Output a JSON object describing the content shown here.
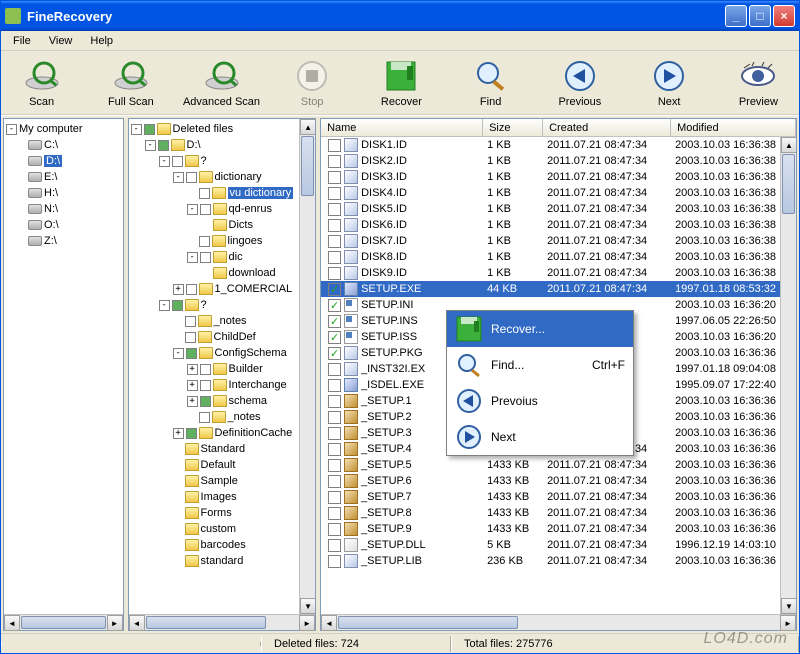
{
  "window": {
    "title": "FineRecovery"
  },
  "menu": {
    "file": "File",
    "view": "View",
    "help": "Help"
  },
  "toolbar": {
    "scan": "Scan",
    "fullscan": "Full Scan",
    "advscan": "Advanced Scan",
    "stop": "Stop",
    "recover": "Recover",
    "find": "Find",
    "previous": "Previous",
    "next": "Next",
    "preview": "Preview"
  },
  "drives": {
    "root": "My computer",
    "items": [
      "C:\\",
      "D:\\",
      "E:\\",
      "H:\\",
      "N:\\",
      "O:\\",
      "Z:\\"
    ]
  },
  "tree": {
    "root": "Deleted files",
    "d": "D:\\",
    "qa": "?",
    "dictionary": "dictionary",
    "vu": "vu dictionary",
    "qdenrus": "qd-enrus",
    "dicts": "Dicts",
    "lingoes": "lingoes",
    "dic": "dic",
    "download": "download",
    "comercial": "1_COMERCIAL",
    "qb": "?",
    "notes": "_notes",
    "childdef": "ChildDef",
    "configschema": "ConfigSchema",
    "builder": "Builder",
    "interchange": "Interchange",
    "schema": "schema",
    "notes2": "_notes",
    "defcache": "DefinitionCache",
    "standard": "Standard",
    "default": "Default",
    "sample": "Sample",
    "images": "Images",
    "forms": "Forms",
    "custom": "custom",
    "barcodes": "barcodes",
    "standard2": "standard"
  },
  "cols": {
    "name": "Name",
    "size": "Size",
    "created": "Created",
    "modified": "Modified"
  },
  "files": [
    {
      "ck": false,
      "name": "DISK1.ID",
      "ico": "id",
      "size": "1 KB",
      "created": "2011.07.21 08:47:34",
      "modified": "2003.10.03 16:36:38"
    },
    {
      "ck": false,
      "name": "DISK2.ID",
      "ico": "id",
      "size": "1 KB",
      "created": "2011.07.21 08:47:34",
      "modified": "2003.10.03 16:36:38"
    },
    {
      "ck": false,
      "name": "DISK3.ID",
      "ico": "id",
      "size": "1 KB",
      "created": "2011.07.21 08:47:34",
      "modified": "2003.10.03 16:36:38"
    },
    {
      "ck": false,
      "name": "DISK4.ID",
      "ico": "id",
      "size": "1 KB",
      "created": "2011.07.21 08:47:34",
      "modified": "2003.10.03 16:36:38"
    },
    {
      "ck": false,
      "name": "DISK5.ID",
      "ico": "id",
      "size": "1 KB",
      "created": "2011.07.21 08:47:34",
      "modified": "2003.10.03 16:36:38"
    },
    {
      "ck": false,
      "name": "DISK6.ID",
      "ico": "id",
      "size": "1 KB",
      "created": "2011.07.21 08:47:34",
      "modified": "2003.10.03 16:36:38"
    },
    {
      "ck": false,
      "name": "DISK7.ID",
      "ico": "id",
      "size": "1 KB",
      "created": "2011.07.21 08:47:34",
      "modified": "2003.10.03 16:36:38"
    },
    {
      "ck": false,
      "name": "DISK8.ID",
      "ico": "id",
      "size": "1 KB",
      "created": "2011.07.21 08:47:34",
      "modified": "2003.10.03 16:36:38"
    },
    {
      "ck": false,
      "name": "DISK9.ID",
      "ico": "id",
      "size": "1 KB",
      "created": "2011.07.21 08:47:34",
      "modified": "2003.10.03 16:36:38"
    },
    {
      "ck": true,
      "name": "SETUP.EXE",
      "ico": "exe",
      "size": "44 KB",
      "created": "2011.07.21 08:47:34",
      "modified": "1997.01.18 08:53:32",
      "sel": true
    },
    {
      "ck": true,
      "name": "SETUP.INI",
      "ico": "ini",
      "size": "",
      "created": "",
      "modified": "2003.10.03 16:36:20"
    },
    {
      "ck": true,
      "name": "SETUP.INS",
      "ico": "ini",
      "size": "",
      "created": "",
      "modified": "1997.06.05 22:26:50"
    },
    {
      "ck": true,
      "name": "SETUP.ISS",
      "ico": "ini",
      "size": "",
      "created": "",
      "modified": "2003.10.03 16:36:20"
    },
    {
      "ck": true,
      "name": "SETUP.PKG",
      "ico": "id",
      "size": "",
      "created": "",
      "modified": "2003.10.03 16:36:36"
    },
    {
      "ck": false,
      "name": "_INST32I.EX",
      "ico": "id",
      "size": "",
      "created": "",
      "modified": "1997.01.18 09:04:08"
    },
    {
      "ck": false,
      "name": "_ISDEL.EXE",
      "ico": "exe",
      "size": "",
      "created": "",
      "modified": "1995.09.07 17:22:40"
    },
    {
      "ck": false,
      "name": "_SETUP.1",
      "ico": "dat",
      "size": "",
      "created": "",
      "modified": "2003.10.03 16:36:36"
    },
    {
      "ck": false,
      "name": "_SETUP.2",
      "ico": "dat",
      "size": "",
      "created": "",
      "modified": "2003.10.03 16:36:36"
    },
    {
      "ck": false,
      "name": "_SETUP.3",
      "ico": "dat",
      "size": "",
      "created": "",
      "modified": "2003.10.03 16:36:36"
    },
    {
      "ck": false,
      "name": "_SETUP.4",
      "ico": "dat",
      "size": "",
      "created": "2011.07.21 08:47:34",
      "modified": "2003.10.03 16:36:36"
    },
    {
      "ck": false,
      "name": "_SETUP.5",
      "ico": "dat",
      "size": "1433 KB",
      "created": "2011.07.21 08:47:34",
      "modified": "2003.10.03 16:36:36"
    },
    {
      "ck": false,
      "name": "_SETUP.6",
      "ico": "dat",
      "size": "1433 KB",
      "created": "2011.07.21 08:47:34",
      "modified": "2003.10.03 16:36:36"
    },
    {
      "ck": false,
      "name": "_SETUP.7",
      "ico": "dat",
      "size": "1433 KB",
      "created": "2011.07.21 08:47:34",
      "modified": "2003.10.03 16:36:36"
    },
    {
      "ck": false,
      "name": "_SETUP.8",
      "ico": "dat",
      "size": "1433 KB",
      "created": "2011.07.21 08:47:34",
      "modified": "2003.10.03 16:36:36"
    },
    {
      "ck": false,
      "name": "_SETUP.9",
      "ico": "dat",
      "size": "1433 KB",
      "created": "2011.07.21 08:47:34",
      "modified": "2003.10.03 16:36:36"
    },
    {
      "ck": false,
      "name": "_SETUP.DLL",
      "ico": "dll",
      "size": "5 KB",
      "created": "2011.07.21 08:47:34",
      "modified": "1996.12.19 14:03:10"
    },
    {
      "ck": false,
      "name": "_SETUP.LIB",
      "ico": "id",
      "size": "236 KB",
      "created": "2011.07.21 08:47:34",
      "modified": "2003.10.03 16:36:36"
    }
  ],
  "ctx": {
    "recover": "Recover...",
    "find": "Find...",
    "findshortcut": "Ctrl+F",
    "prev": "Prevoius",
    "next": "Next"
  },
  "status": {
    "deleted_label": "Deleted files: 724",
    "total_label": "Total files: 275776"
  },
  "watermark": "LO4D.com"
}
